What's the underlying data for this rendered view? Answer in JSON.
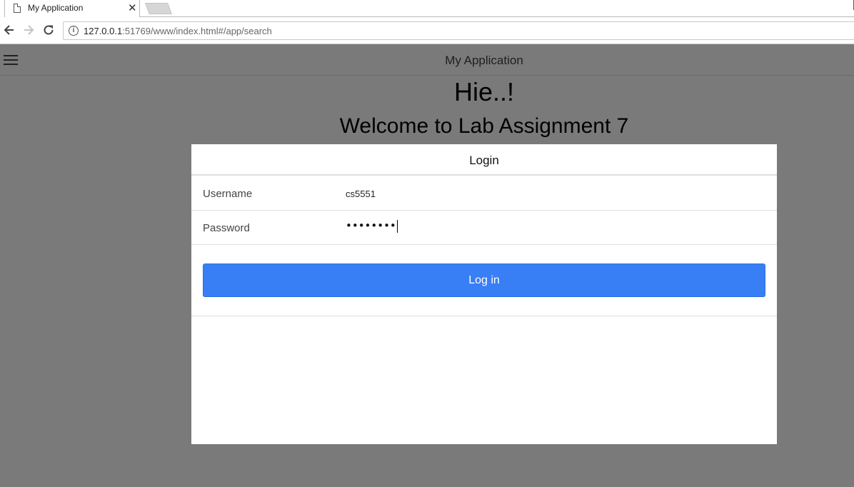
{
  "browser": {
    "tab_title": "My Application",
    "tab_close": "✕",
    "url_host": "127.0.0.1",
    "url_rest": ":51769/www/index.html#/app/search",
    "icons": [
      "page-icon",
      "close-icon",
      "back-arrow-icon",
      "forward-arrow-icon",
      "reload-icon",
      "info-icon"
    ]
  },
  "header": {
    "title": "My Application",
    "menu_icon": "hamburger-menu-icon"
  },
  "main": {
    "greeting": "Hie..!",
    "welcome": "Welcome to Lab Assignment 7"
  },
  "login_modal": {
    "title": "Login",
    "username_label": "Username",
    "username_value": "cs5551",
    "password_label": "Password",
    "password_mask": "••••••••",
    "submit_label": "Log in"
  },
  "colors": {
    "overlay": "#7a7a7a",
    "button": "#387ef5",
    "button_text": "#ffffff"
  }
}
